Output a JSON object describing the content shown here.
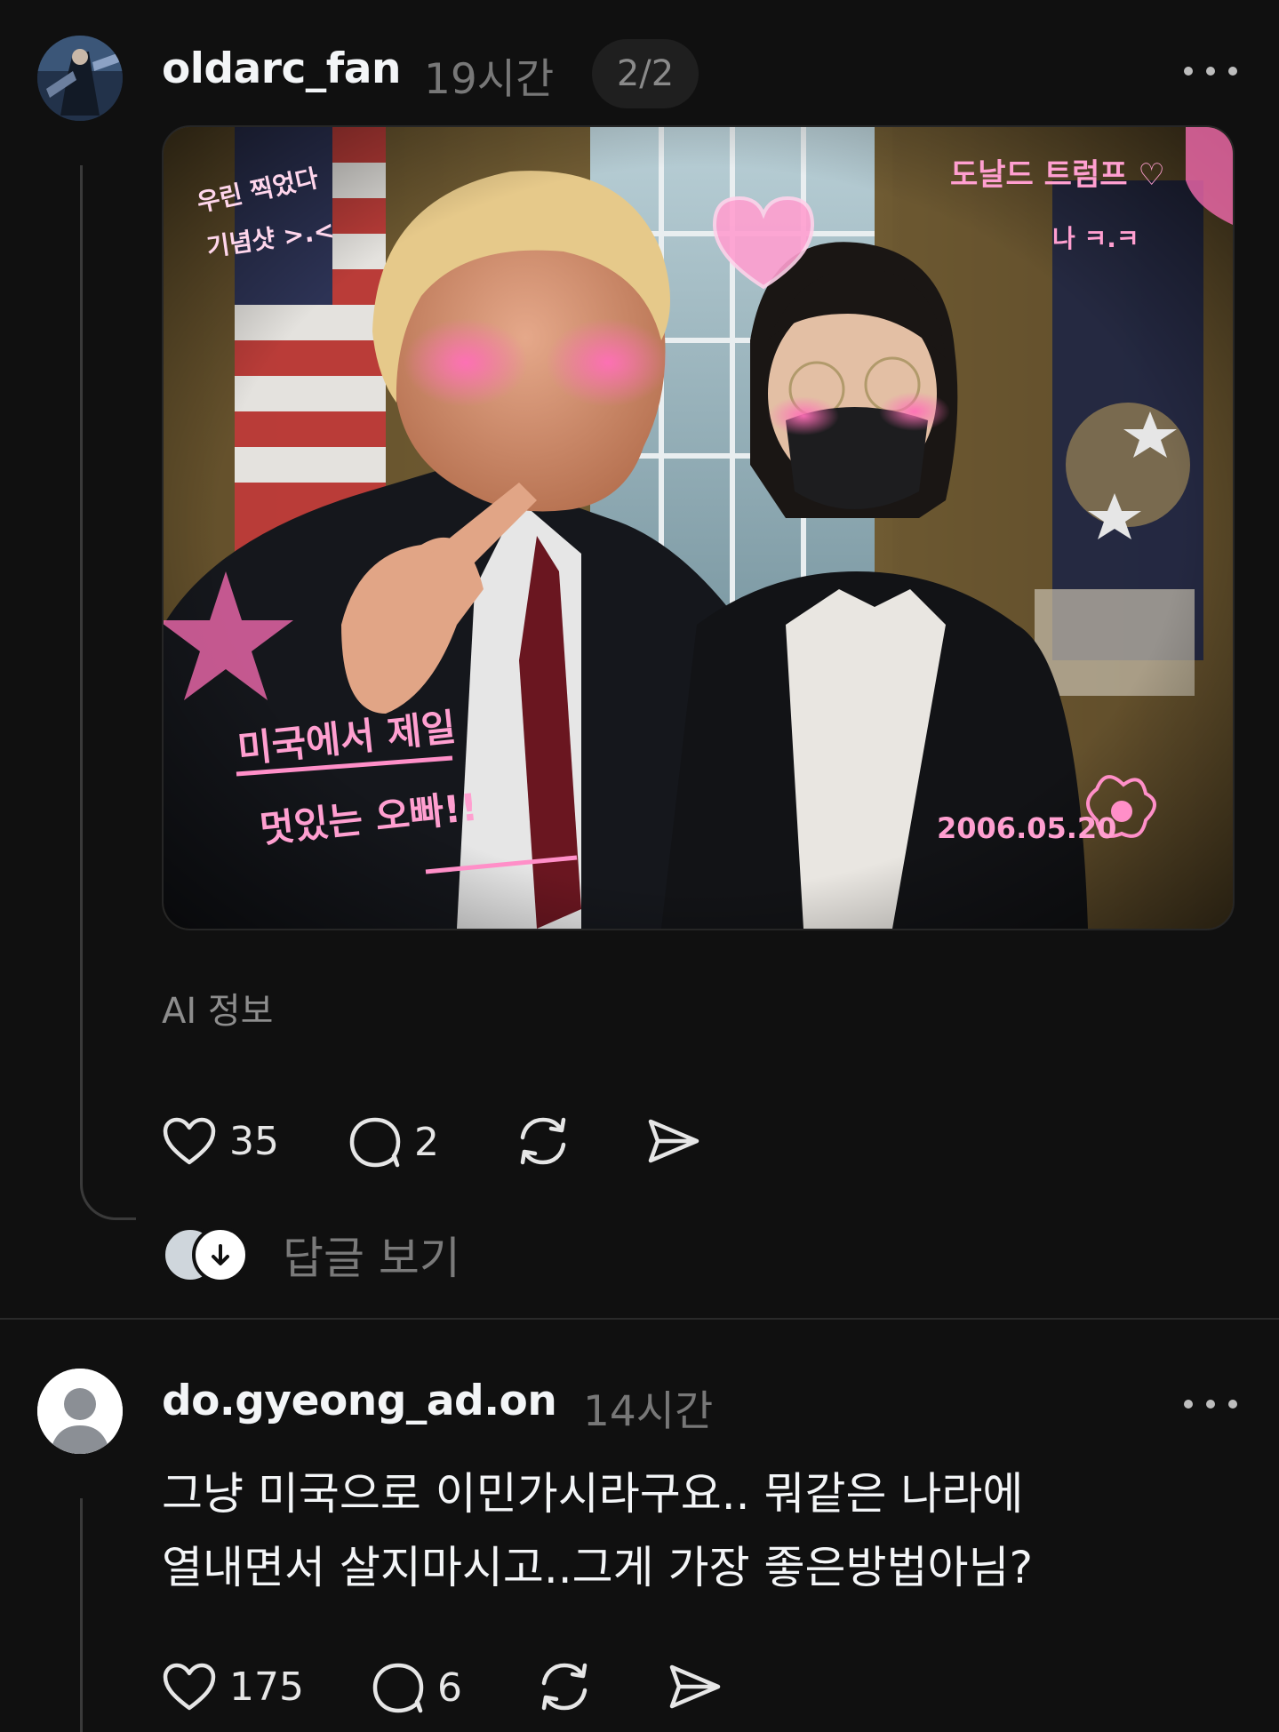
{
  "post1": {
    "username": "oldarc_fan",
    "time": "19시간",
    "pager": "2/2",
    "photo": {
      "overlay_texts": [
        "우린 찍었다",
        "기념샷 >.<",
        "도날드 트럼프 ♡",
        "나 ㅋ.ㅋ",
        "미국에서 제일",
        "멋있는 오빠!!",
        "2006.05.20"
      ]
    },
    "ai_info": "AI 정보",
    "likes": "35",
    "comments": "2",
    "see_replies": "답글 보기"
  },
  "post2": {
    "username": "do.gyeong_ad.on",
    "time": "14시간",
    "text_lines": [
      "그냥 미국으로 이민가시라구요.. 뭐같은 나라에",
      "열내면서 살지마시고..그게 가장 좋은방법아님?"
    ],
    "likes": "175",
    "comments": "6"
  },
  "icons": {
    "more": "more-horizontal-icon",
    "like": "heart-icon",
    "comment": "comment-bubble-icon",
    "repost": "repost-icon",
    "share": "share-send-icon"
  },
  "colors": {
    "background": "#101010",
    "text": "#f3f5f7",
    "muted": "#777777",
    "sticker_pink": "#ff8fc8"
  }
}
